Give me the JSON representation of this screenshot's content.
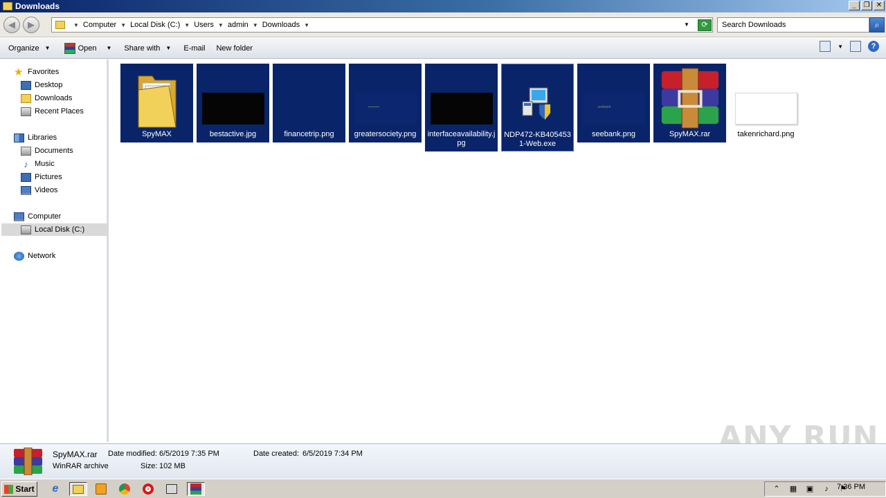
{
  "window": {
    "title": "Downloads"
  },
  "address": {
    "crumbs": [
      "Computer",
      "Local Disk (C:)",
      "Users",
      "admin",
      "Downloads"
    ],
    "search_placeholder": "Search Downloads"
  },
  "toolbar": {
    "organize": "Organize",
    "open": "Open",
    "share_with": "Share with",
    "email": "E-mail",
    "new_folder": "New folder"
  },
  "sidebar": {
    "favorites": "Favorites",
    "desktop": "Desktop",
    "downloads": "Downloads",
    "recent_places": "Recent Places",
    "libraries": "Libraries",
    "documents": "Documents",
    "music": "Music",
    "pictures": "Pictures",
    "videos": "Videos",
    "computer": "Computer",
    "local_disk": "Local Disk (C:)",
    "network": "Network"
  },
  "files": [
    {
      "name": "SpyMAX",
      "kind": "folder",
      "selected": true
    },
    {
      "name": "bestactive.jpg",
      "kind": "image-dark",
      "selected": true
    },
    {
      "name": "financetrip.png",
      "kind": "image-blank",
      "selected": true
    },
    {
      "name": "greatersociety.png",
      "kind": "image-blank",
      "selected": true
    },
    {
      "name": "interfaceavailability.jpg",
      "kind": "image-dark",
      "selected": true
    },
    {
      "name": "NDP472-KB4054531-Web.exe",
      "kind": "installer",
      "selected": true
    },
    {
      "name": "seebank.png",
      "kind": "image-blank",
      "selected": true,
      "thumb_text": "seebank"
    },
    {
      "name": "SpyMAX.rar",
      "kind": "rar",
      "selected": true
    },
    {
      "name": "takenrichard.png",
      "kind": "image-white",
      "selected": false
    }
  ],
  "details": {
    "file_name": "SpyMAX.rar",
    "file_type": "WinRAR archive",
    "date_modified_label": "Date modified:",
    "date_modified": "6/5/2019 7:35 PM",
    "date_created_label": "Date created:",
    "date_created": "6/5/2019 7:34 PM",
    "size_label": "Size:",
    "size": "102 MB"
  },
  "watermark": "ANY RUN",
  "taskbar": {
    "start": "Start",
    "clock": "7:36 PM"
  }
}
